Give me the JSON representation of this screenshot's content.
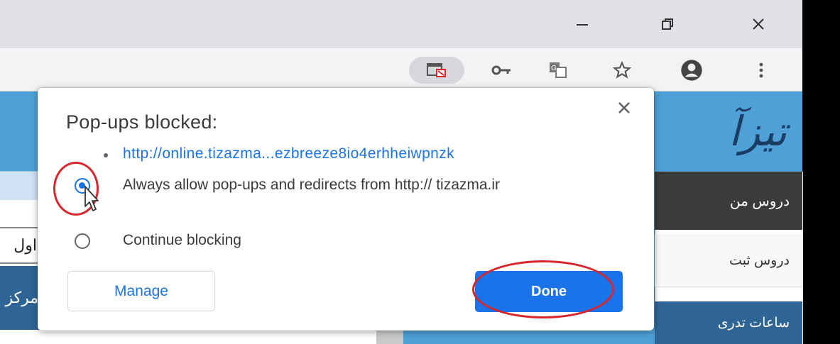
{
  "browser": {
    "window_controls": {
      "minimize_icon": "minimize-icon",
      "restore_icon": "restore-icon",
      "close_icon": "close-icon"
    },
    "toolbar_icons": [
      "popup-blocked-icon",
      "key-icon",
      "translate-icon",
      "star-icon",
      "account-icon",
      "more-menu-icon"
    ]
  },
  "background_page": {
    "logo_text": "تیزآ",
    "side_menu": {
      "header": "دروس من",
      "item": "دروس ثبت",
      "footer": "ساعات تدری"
    },
    "left_input_text": "اول",
    "left_button_text": "مرکز"
  },
  "dialog": {
    "title": "Pop-ups blocked:",
    "blocked_url": "http://online.tizazma...ezbreeze8io4erhheiwpnzk",
    "option_allow": "Always allow pop-ups and redirects from http:// tizazma.ir",
    "option_block": "Continue blocking",
    "selected_option": "allow",
    "manage_label": "Manage",
    "done_label": "Done"
  },
  "colors": {
    "accent": "#1a73e8",
    "annotation_red": "#d9262c",
    "page_blue": "#4fa0d6"
  }
}
